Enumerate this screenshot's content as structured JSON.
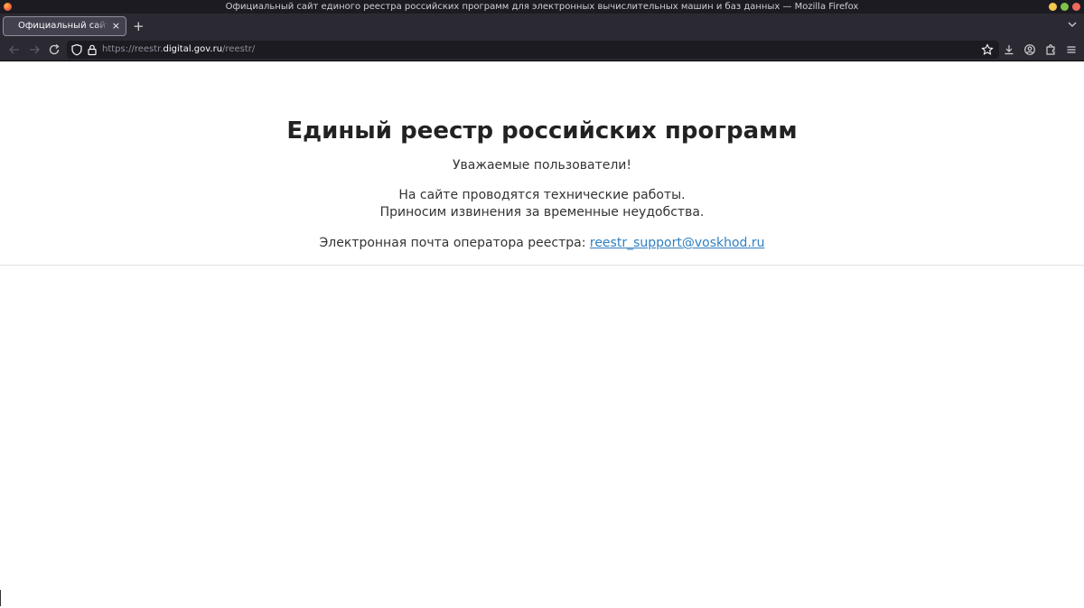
{
  "window": {
    "title": "Официальный сайт единого реестра российских программ для электронных вычислительных машин и баз данных — Mozilla Firefox"
  },
  "tabs": [
    {
      "label": "Официальный сайт единого реестра российских программ",
      "close": "×"
    }
  ],
  "tabstrip": {
    "new_tab": "+"
  },
  "address_bar": {
    "url_prefix": "https://reestr.",
    "url_host": "digital.gov.ru",
    "url_path": "/reestr/"
  },
  "page": {
    "title": "Единый реестр российских программ",
    "greeting": "Уважаемые пользователи!",
    "maintenance_line1": "На сайте проводятся технические работы.",
    "maintenance_line2": "Приносим извинения за временные неудобства.",
    "contact_label": "Электронная почта оператора реестра: ",
    "contact_email": "reestr_support@voskhod.ru"
  },
  "colors": {
    "chrome_dark": "#2b2a33",
    "titlebar": "#1c1b22",
    "link": "#2f7fc1"
  }
}
